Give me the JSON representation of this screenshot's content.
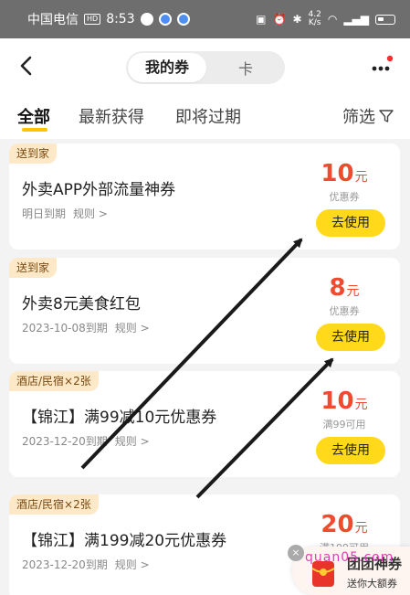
{
  "status_bar": {
    "carrier": "中国电信",
    "hd": "HD",
    "time": "8:53",
    "net_speed_value": "4.2",
    "net_speed_unit": "K/s"
  },
  "header": {
    "segments": [
      "我的券",
      "卡"
    ],
    "active_segment": "我的券"
  },
  "tabs": {
    "items": [
      "全部",
      "最新获得",
      "即将过期"
    ],
    "active": "全部",
    "filter_label": "筛选"
  },
  "coupons": [
    {
      "tag": "送到家",
      "title": "外卖APP外部流量神券",
      "expiry": "明日到期",
      "rule": "规则 >",
      "amount": "10",
      "unit": "元",
      "sub": "优惠券",
      "action": "去使用"
    },
    {
      "tag": "送到家",
      "title": "外卖8元美食红包",
      "expiry": "2023-10-08到期",
      "rule": "规则 >",
      "amount": "8",
      "unit": "元",
      "sub": "优惠券",
      "action": "去使用"
    },
    {
      "tag": "酒店/民宿×2张",
      "title": "【锦江】满99减10元优惠券",
      "expiry": "2023-12-20到期",
      "rule": "规则 >",
      "amount": "10",
      "unit": "元",
      "sub": "满99可用",
      "action": "去使用"
    },
    {
      "tag": "酒店/民宿×2张",
      "title": "【锦江】满199减20元优惠券",
      "expiry": "2023-12-20到期",
      "rule": "规则 >",
      "amount": "20",
      "unit": "元",
      "sub": "满199可用",
      "action": ""
    }
  ],
  "float_widget": {
    "title": "团团神券",
    "subtitle": "送你大额券",
    "close": "×"
  },
  "watermark": "quan05.com",
  "colors": {
    "accent_yellow": "#ffd91a",
    "price_red": "#f04a2f",
    "tag_bg": "#fde8c7",
    "page_bg": "#f3f3f3"
  }
}
